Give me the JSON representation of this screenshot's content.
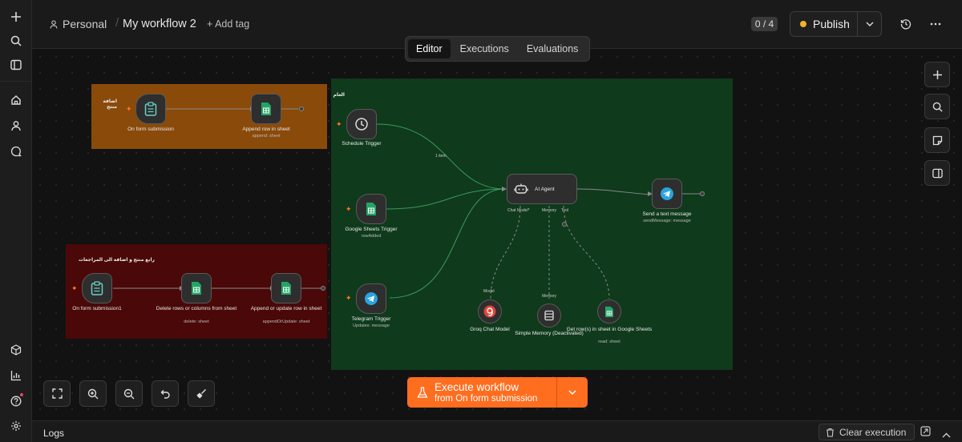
{
  "header": {
    "workspace": "Personal",
    "separator": "/",
    "workflow_title": "My workflow 2",
    "add_tag": "+ Add tag",
    "counter": "0 / 4",
    "publish_label": "Publish"
  },
  "tabs": [
    {
      "label": "Editor",
      "active": true
    },
    {
      "label": "Executions",
      "active": false
    },
    {
      "label": "Evaluations",
      "active": false
    }
  ],
  "sticky_notes": [
    {
      "title": "اضافة منتج",
      "color": "#8a4a0a"
    },
    {
      "title": "العام",
      "color": "#0f3a1c"
    },
    {
      "title": "رابع منتج و اضافة الى المراجعات",
      "color": "#4a0808"
    }
  ],
  "nodes": {
    "form1": {
      "label": "On form submission",
      "icon": "clipboard-icon"
    },
    "append1": {
      "label": "Append row in sheet",
      "sub": "append: sheet",
      "icon": "sheets-icon"
    },
    "schedule": {
      "label": "Schedule Trigger",
      "icon": "clock-icon"
    },
    "gsheets_trigger": {
      "label": "Google Sheets Trigger",
      "sub": "rowAdded",
      "icon": "sheets-icon"
    },
    "telegram_trigger": {
      "label": "Telegram Trigger",
      "sub": "Updates: message",
      "icon": "telegram-icon"
    },
    "agent": {
      "label": "AI Agent",
      "icon": "robot-icon",
      "ports": [
        "Chat Model*",
        "Memory",
        "Tool"
      ]
    },
    "send_msg": {
      "label": "Send a text message",
      "sub": "sendMessage: message",
      "icon": "telegram-icon"
    },
    "groq": {
      "label": "Groq Chat Model",
      "port": "Model",
      "icon": "groq-icon"
    },
    "memory": {
      "label": "Simple Memory (Deactivated)",
      "port": "Memory",
      "icon": "database-icon"
    },
    "get_rows": {
      "label": "Get row(s) in sheet in Google Sheets",
      "sub": "read: sheet",
      "icon": "sheets-icon"
    },
    "form2": {
      "label": "On form submission1",
      "icon": "clipboard-icon"
    },
    "delete_rows": {
      "label": "Delete rows or columns from sheet",
      "sub": "delete: sheet",
      "icon": "sheets-icon"
    },
    "append_update": {
      "label": "Append or update row in sheet",
      "sub": "appendOrUpdate: sheet",
      "icon": "sheets-icon"
    },
    "edge_label_items": "1 item"
  },
  "execute": {
    "line1": "Execute workflow",
    "line2": "from On form submission"
  },
  "logs": {
    "label": "Logs",
    "clear": "Clear execution"
  },
  "colors": {
    "accent": "#ff6d1f",
    "publish_dot": "#f0b429"
  }
}
